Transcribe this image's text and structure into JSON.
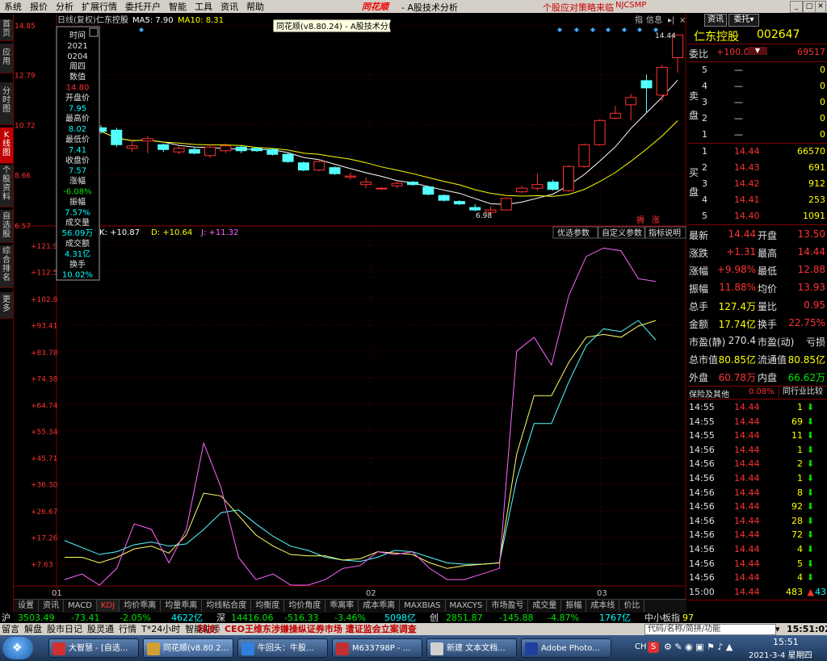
{
  "menu": {
    "items": [
      "系统",
      "报价",
      "分析",
      "扩展行情",
      "委托开户",
      "智能",
      "工具",
      "资讯",
      "帮助"
    ],
    "logo": "同花顺",
    "app_title": "- A股技术分析",
    "promo": "个股应对策略来临",
    "code": "NJCSMP"
  },
  "left_tabs": [
    "首页",
    "应用",
    "分时图",
    "K线图",
    "个股资料",
    "自选股",
    "综合排名",
    "更多"
  ],
  "chart": {
    "header_label": "日线(复权)",
    "stock_name": "仁东控股",
    "ma5": "MA5: 7.90",
    "ma10": "MA10: 8.31",
    "tooltip_title": "同花顺(v8.80.24) - A股技术分析",
    "y_ticks": [
      "14.85",
      "12.79",
      "10.72",
      "8.66",
      "6.57"
    ],
    "high_label": "14.44",
    "low_label": "6.98",
    "tag_left": "褥",
    "tag_right": "涨",
    "btn_info": "信息",
    "btn_zhi": "指",
    "kdj_k": "K: +10.87",
    "kdj_d": "D: +10.64",
    "kdj_j": "J: +11.32",
    "param_btns": [
      "优选参数",
      "自定义参数",
      "指标说明"
    ],
    "kdj_ticks": [
      "+121.9",
      "+112.5",
      "+102.8",
      "+93.41",
      "+83.78",
      "+74.38",
      "+64.74",
      "+55.34",
      "+45.71",
      "+36.30",
      "+26.67",
      "+17.26",
      "+7.63"
    ],
    "x_labels": [
      "01",
      "02",
      "03"
    ]
  },
  "info_box": {
    "labels": [
      "时间",
      "2021",
      "0204",
      "周四",
      "数值",
      "14.80",
      "开盘价",
      "7.95",
      "最高价",
      "8.02",
      "最低价",
      "7.41",
      "收盘价",
      "7.57",
      "涨幅",
      "-6.08%",
      "振幅",
      "7.57%",
      "成交量",
      "56.09万",
      "成交额",
      "4.31亿",
      "换手",
      "10.02%"
    ]
  },
  "candles": [
    {
      "o": 10.6,
      "h": 10.7,
      "l": 10.35,
      "c": 10.45
    },
    {
      "o": 10.5,
      "h": 10.6,
      "l": 9.8,
      "c": 9.9
    },
    {
      "o": 9.75,
      "h": 10.05,
      "l": 9.6,
      "c": 9.85
    },
    {
      "o": 10.05,
      "h": 10.25,
      "l": 9.55,
      "c": 10.15
    },
    {
      "o": 9.9,
      "h": 9.95,
      "l": 9.6,
      "c": 9.7
    },
    {
      "o": 9.6,
      "h": 9.85,
      "l": 9.5,
      "c": 9.75
    },
    {
      "o": 9.7,
      "h": 9.8,
      "l": 9.5,
      "c": 9.55
    },
    {
      "o": 9.45,
      "h": 9.9,
      "l": 9.35,
      "c": 9.8
    },
    {
      "o": 9.65,
      "h": 9.95,
      "l": 9.55,
      "c": 9.85
    },
    {
      "o": 9.8,
      "h": 9.85,
      "l": 9.55,
      "c": 9.65
    },
    {
      "o": 9.75,
      "h": 9.8,
      "l": 9.6,
      "c": 9.65
    },
    {
      "o": 9.7,
      "h": 9.75,
      "l": 9.45,
      "c": 9.5
    },
    {
      "o": 9.5,
      "h": 9.55,
      "l": 9.15,
      "c": 9.2
    },
    {
      "o": 9.15,
      "h": 9.2,
      "l": 8.8,
      "c": 8.85
    },
    {
      "o": 8.85,
      "h": 9.25,
      "l": 8.8,
      "c": 9.2
    },
    {
      "o": 8.95,
      "h": 9.0,
      "l": 8.65,
      "c": 8.7
    },
    {
      "o": 8.55,
      "h": 8.75,
      "l": 8.45,
      "c": 8.6
    },
    {
      "o": 8.25,
      "h": 8.55,
      "l": 8.1,
      "c": 8.35
    },
    {
      "o": 8.1,
      "h": 8.15,
      "l": 8.05,
      "c": 8.1
    },
    {
      "o": 8.2,
      "h": 8.4,
      "l": 8.1,
      "c": 8.3
    },
    {
      "o": 8.35,
      "h": 8.4,
      "l": 8.2,
      "c": 8.25
    },
    {
      "o": 8.15,
      "h": 8.2,
      "l": 7.8,
      "c": 7.85
    },
    {
      "o": 7.8,
      "h": 7.85,
      "l": 7.55,
      "c": 7.6
    },
    {
      "o": 7.55,
      "h": 7.6,
      "l": 7.4,
      "c": 7.45
    },
    {
      "o": 7.3,
      "h": 7.45,
      "l": 7.15,
      "c": 7.2
    },
    {
      "o": 7.1,
      "h": 7.35,
      "l": 6.98,
      "c": 7.2
    },
    {
      "o": 7.2,
      "h": 7.7,
      "l": 7.18,
      "c": 7.68
    },
    {
      "o": 7.95,
      "h": 8.2,
      "l": 7.9,
      "c": 8.1
    },
    {
      "o": 8.1,
      "h": 8.7,
      "l": 8.0,
      "c": 8.25
    },
    {
      "o": 8.35,
      "h": 8.45,
      "l": 8.0,
      "c": 8.05
    },
    {
      "o": 8.0,
      "h": 9.05,
      "l": 7.95,
      "c": 9.0
    },
    {
      "o": 9.0,
      "h": 9.95,
      "l": 8.95,
      "c": 9.9
    },
    {
      "o": 9.9,
      "h": 10.95,
      "l": 9.85,
      "c": 10.9
    },
    {
      "o": 11.0,
      "h": 11.5,
      "l": 10.95,
      "c": 11.2
    },
    {
      "o": 11.55,
      "h": 12.0,
      "l": 10.9,
      "c": 11.85
    },
    {
      "o": 12.55,
      "h": 12.8,
      "l": 11.2,
      "c": 12.25
    },
    {
      "o": 11.95,
      "h": 13.2,
      "l": 11.7,
      "c": 13.1
    },
    {
      "o": 13.5,
      "h": 14.44,
      "l": 12.88,
      "c": 14.44
    }
  ],
  "kdj": {
    "k": [
      16,
      13.5,
      11,
      12,
      14.5,
      15.5,
      14,
      14.8,
      20,
      26,
      27,
      22,
      17.5,
      14,
      12.5,
      10,
      9,
      8.5,
      10,
      12.5,
      12,
      10,
      8,
      7.5,
      7.5,
      8,
      38,
      58,
      58,
      73,
      86,
      92,
      91,
      95,
      88
    ],
    "d": [
      10,
      10,
      8,
      10,
      13,
      14,
      11.5,
      18,
      33,
      32,
      25,
      18,
      14,
      11,
      10.5,
      10.5,
      9,
      9.5,
      12,
      11.5,
      11,
      8,
      6,
      7,
      7.5,
      8,
      47,
      68,
      68,
      80,
      89,
      90,
      89,
      93,
      95
    ],
    "j": [
      2,
      4,
      0,
      6,
      22,
      20,
      8,
      20,
      51,
      35,
      10,
      2,
      4,
      0,
      0,
      2,
      6,
      7,
      12,
      11,
      12,
      6,
      2,
      2,
      4,
      6,
      84,
      89,
      79,
      104,
      118,
      121,
      120,
      110,
      109
    ]
  },
  "quote": {
    "btn_news": "资讯",
    "btn_order": "委托",
    "name": "仁东控股",
    "code": "002647",
    "weibi_label": "委比",
    "weibi_pct": "+100.00%",
    "weibi_val": "69517",
    "sell_label": "卖盘",
    "buy_label": "买盘",
    "sell": [
      {
        "lv": "5",
        "p": "—",
        "v": "0"
      },
      {
        "lv": "4",
        "p": "—",
        "v": "0"
      },
      {
        "lv": "3",
        "p": "—",
        "v": "0"
      },
      {
        "lv": "2",
        "p": "—",
        "v": "0"
      },
      {
        "lv": "1",
        "p": "—",
        "v": "0"
      }
    ],
    "buy": [
      {
        "lv": "1",
        "p": "14.44",
        "v": "66570"
      },
      {
        "lv": "2",
        "p": "14.43",
        "v": "691"
      },
      {
        "lv": "3",
        "p": "14.42",
        "v": "912"
      },
      {
        "lv": "4",
        "p": "14.41",
        "v": "253"
      },
      {
        "lv": "5",
        "p": "14.40",
        "v": "1091"
      }
    ],
    "stats": [
      {
        "l1": "最新",
        "v1": "14.44",
        "l2": "开盘",
        "v2": "13.50"
      },
      {
        "l1": "涨跌",
        "v1": "+1.31",
        "l2": "最高",
        "v2": "14.44"
      },
      {
        "l1": "涨幅",
        "v1": "+9.98%",
        "l2": "最低",
        "v2": "12.88"
      },
      {
        "l1": "振幅",
        "v1": "11.88%",
        "l2": "均价",
        "v2": "13.93"
      },
      {
        "l1": "总手",
        "v1": "127.4万",
        "l2": "量比",
        "v2": "0.95"
      },
      {
        "l1": "金额",
        "v1": "17.74亿",
        "l2": "换手",
        "v2": "22.75%"
      },
      {
        "l1": "市盈(静)",
        "v1": "270.4",
        "l2": "市盈(动)",
        "v2": "亏损"
      },
      {
        "l1": "总市值",
        "v1": "80.85亿",
        "l2": "流通值",
        "v2": "80.85亿"
      },
      {
        "l1": "外盘",
        "v1": "60.78万",
        "l2": "内盘",
        "v2": "66.62万"
      }
    ],
    "sector_label": "保险及其他",
    "sector_pct": "0.08%",
    "peer_label": "同行业比较",
    "ticks": [
      {
        "t": "14:55",
        "p": "14.44",
        "v": "1"
      },
      {
        "t": "14:55",
        "p": "14.44",
        "v": "69"
      },
      {
        "t": "14:55",
        "p": "14.44",
        "v": "11"
      },
      {
        "t": "14:56",
        "p": "14.44",
        "v": "1"
      },
      {
        "t": "14:56",
        "p": "14.44",
        "v": "2"
      },
      {
        "t": "14:56",
        "p": "14.44",
        "v": "1"
      },
      {
        "t": "14:56",
        "p": "14.44",
        "v": "8"
      },
      {
        "t": "14:56",
        "p": "14.44",
        "v": "92"
      },
      {
        "t": "14:56",
        "p": "14.44",
        "v": "28"
      },
      {
        "t": "14:56",
        "p": "14.44",
        "v": "72"
      },
      {
        "t": "14:56",
        "p": "14.44",
        "v": "4"
      },
      {
        "t": "14:56",
        "p": "14.44",
        "v": "5"
      },
      {
        "t": "14:56",
        "p": "14.44",
        "v": "4"
      },
      {
        "t": "15:00",
        "p": "14.44",
        "v": "483"
      }
    ],
    "tick_extra": "43"
  },
  "bottom_tabs": [
    "设置",
    "资讯",
    "MACD",
    "KDJ",
    "均价乖离",
    "均量乖离",
    "均线粘合度",
    "均衡度",
    "均价角度",
    "乖离率",
    "成本乖离",
    "MAXBIAS",
    "MAXCYS",
    "市场盈亏",
    "成交量",
    "振幅",
    "成本线",
    "价比"
  ],
  "index_bar": {
    "sh": "沪",
    "sh_val": "3503.49",
    "sh_chg": "-73.41",
    "sh_pct": "-2.05%",
    "sh_amt": "4622亿",
    "sz": "深",
    "sz_val": "14416.06",
    "sz_chg": "-516.33",
    "sz_pct": "-3.46%",
    "sz_amt": "5098亿",
    "cy": "创",
    "cy_val": "2851.87",
    "cy_chg": "-145.88",
    "cy_pct": "-4.87%",
    "cy_amt": "1767亿",
    "zx": "中小板指",
    "zx_val": "97"
  },
  "news_bar": {
    "items": [
      "留言",
      "解盘",
      "股市日记",
      "股灵通",
      "行情",
      "T*24小时",
      "智能助手"
    ],
    "headline": "科技：CEO王维东涉嫌操纵证券市场 遭证监会立案调查",
    "search_placeholder": "代码/名称/简拼/功能",
    "clock": "15:51:02"
  },
  "taskbar": {
    "tasks": [
      "大智慧 - [自选...",
      "同花顺(v8.80.2...",
      "牛回头：牛股...",
      "M633798P - ...",
      "新建 文本文档...",
      "Adobe Photo..."
    ],
    "lang": "CH",
    "time": "15:51",
    "date": "2021-3-4 星期四"
  }
}
